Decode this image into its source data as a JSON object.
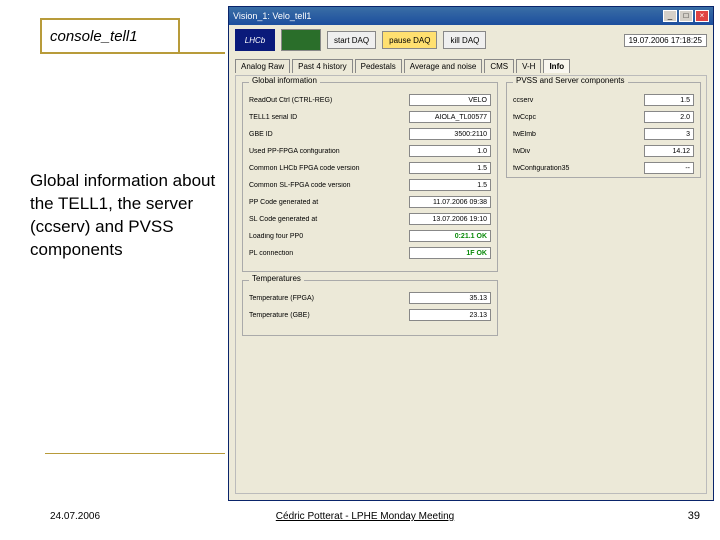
{
  "slide": {
    "title": "console_tell1",
    "body": "Global information about the TELL1, the server (ccserv) and PVSS components",
    "footer_date": "24.07.2006",
    "footer_center": "Cédric Potterat - LPHE Monday Meeting",
    "page_num": "39"
  },
  "window": {
    "title": "Vision_1: Velo_tell1",
    "ctrl_min": "_",
    "ctrl_max": "□",
    "ctrl_close": "×",
    "logo_text": "LHCb",
    "btn_start": "start DAQ",
    "btn_pause": "pause DAQ",
    "btn_kill": "kill DAQ",
    "timestamp": "19.07.2006  17:18:25"
  },
  "tabs": {
    "t0": "Analog Raw",
    "t1": "Past 4 history",
    "t2": "Pedestals",
    "t3": "Average and noise",
    "t4": "CMS",
    "t5": "V-H",
    "t6": "Info"
  },
  "groups": {
    "global": {
      "title": "Global information",
      "rows": {
        "r0": {
          "lbl": "ReadOut Ctrl (CTRL-REG)",
          "val": "VELO"
        },
        "r1": {
          "lbl": "TELL1 serial ID",
          "val": "AIOLA_TL00577"
        },
        "r2": {
          "lbl": "GBE ID",
          "val": "3500:2110"
        },
        "r3": {
          "lbl": "Used PP-FPGA configuration",
          "val": "1.0"
        },
        "r4": {
          "lbl": "Common LHCb FPGA code version",
          "val": "1.5"
        },
        "r5": {
          "lbl": "Common SL-FPGA code version",
          "val": "1.5"
        },
        "r6": {
          "lbl": "PP Code generated at",
          "val": "11.07.2006   09:38"
        },
        "r7": {
          "lbl": "SL Code generated at",
          "val": "13.07.2006   19:10"
        },
        "r8": {
          "lbl": "Loading four PP0",
          "val": "0:21.1   OK"
        },
        "r9": {
          "lbl": "PL  connection",
          "val": "1F   OK"
        }
      }
    },
    "pvss": {
      "title": "PVSS and Server components",
      "rows": {
        "r0": {
          "lbl": "ccserv",
          "val": "1.5"
        },
        "r1": {
          "lbl": "fwCcpc",
          "val": "2.0"
        },
        "r2": {
          "lbl": "fwElmb",
          "val": "3"
        },
        "r3": {
          "lbl": "fwDiv",
          "val": "14.12"
        },
        "r4": {
          "lbl": "fwConfiguration35",
          "val": "--"
        }
      }
    },
    "temp": {
      "title": "Temperatures",
      "rows": {
        "r0": {
          "lbl": "Temperature (FPGA)",
          "val": "35.13"
        },
        "r1": {
          "lbl": "Temperature (GBE)",
          "val": "23.13"
        }
      }
    }
  }
}
